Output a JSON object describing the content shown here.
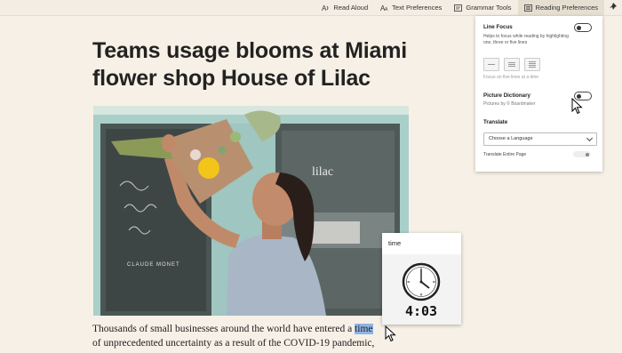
{
  "toolbar": {
    "read_aloud": "Read Aloud",
    "text_preferences": "Text Preferences",
    "grammar_tools": "Grammar Tools",
    "reading_preferences": "Reading Preferences",
    "icons": [
      "read-aloud-icon",
      "text-preferences-icon",
      "grammar-tools-icon",
      "reading-preferences-icon",
      "pin-icon"
    ]
  },
  "article": {
    "headline": "Teams usage blooms at Miami flower shop House of Lilac",
    "body_before": "Thousands of small businesses around the world have entered a ",
    "body_highlight": "time",
    "body_after": "of unprecedented uncertainty as a result of the COVID-19 pandemic,",
    "photo_sign_text": "lilac",
    "photo_window_text": "CLAUDE MONET"
  },
  "reading_prefs": {
    "line_focus_title": "Line Focus",
    "line_focus_desc": "Helps to focus while reading by highlighting one, three or five lines",
    "line_focus_hint": "Focus on five lines at a time",
    "picture_dictionary_title": "Picture Dictionary",
    "picture_dictionary_credit": "Pictures by © Boardmaker",
    "translate_title": "Translate",
    "language_select": "Choose a Language",
    "translate_entire_page": "Translate Entire Page"
  },
  "popup": {
    "word": "time",
    "clock_reading": "4:03"
  },
  "colors": {
    "background": "#f7f0e6",
    "highlight": "#8fb4e6",
    "panel": "#ffffff"
  }
}
